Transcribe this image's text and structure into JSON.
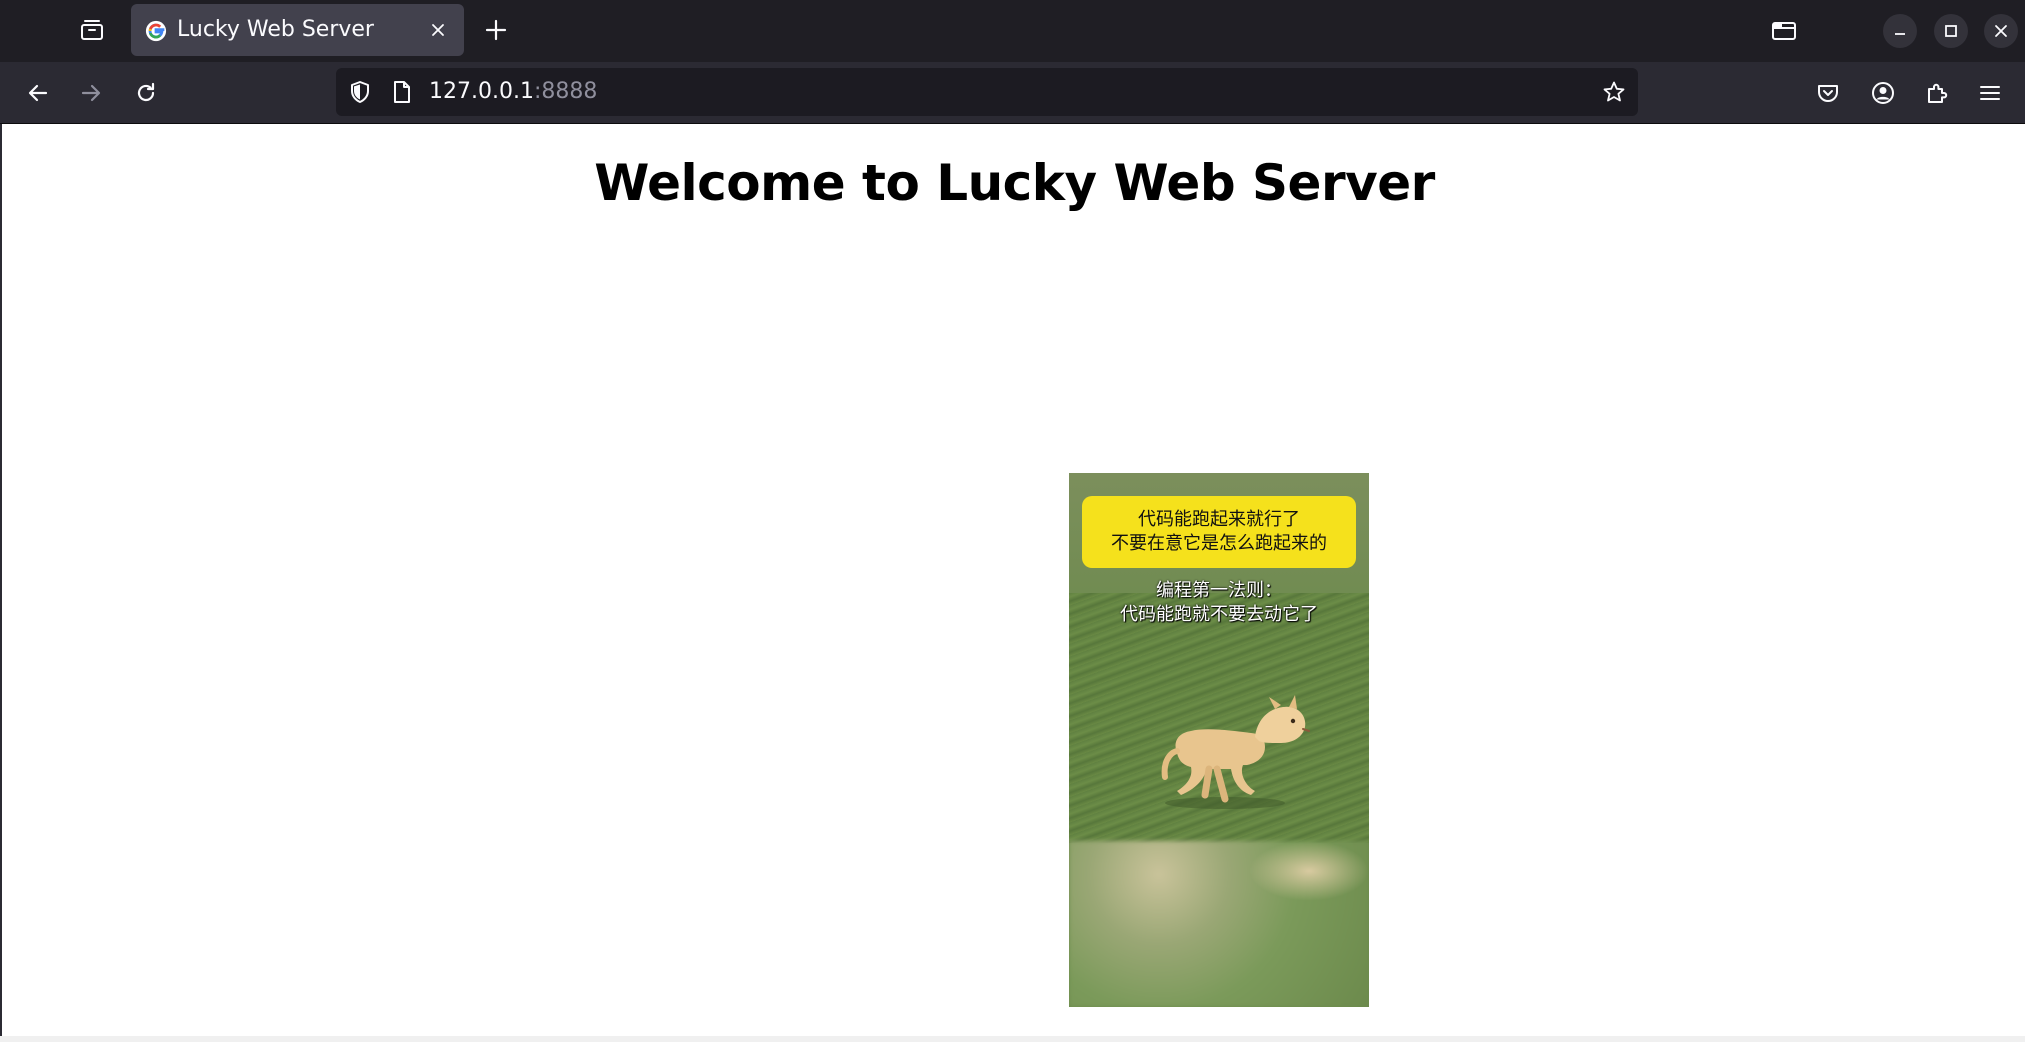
{
  "browser": {
    "tab": {
      "title": "Lucky Web Server"
    },
    "address": {
      "host": "127.0.0.1",
      "port": ":8888"
    }
  },
  "page": {
    "heading": "Welcome to Lucky Web Server",
    "meme": {
      "caption_lines": [
        "代码能跑起来就行了",
        "不要在意它是怎么跑起来的"
      ],
      "subtitle_lines": [
        "编程第一法则：",
        "代码能跑就不要去动它了"
      ]
    }
  },
  "colors": {
    "tabbar_bg": "#1f1e24",
    "toolbar_bg": "#2b2a33",
    "urlbar_bg": "#1c1b22",
    "active_tab_bg": "#42414d",
    "caption_yellow": "#f5e11c"
  },
  "icons": {
    "tab_list": "tab-list-icon",
    "favicon": "google-g-icon",
    "tab_close": "close-icon",
    "new_tab": "plus-icon",
    "back": "arrow-left-icon",
    "forward": "arrow-right-icon",
    "reload": "reload-icon",
    "tracking": "shield-icon",
    "page": "page-icon",
    "bookmark": "star-icon",
    "pocket": "pocket-icon",
    "account": "account-icon",
    "extensions": "puzzle-icon",
    "menu": "hamburger-menu-icon",
    "tab_view": "folder-tab-icon",
    "minimize": "minimize-icon",
    "maximize": "maximize-icon",
    "close_window": "close-window-icon"
  }
}
